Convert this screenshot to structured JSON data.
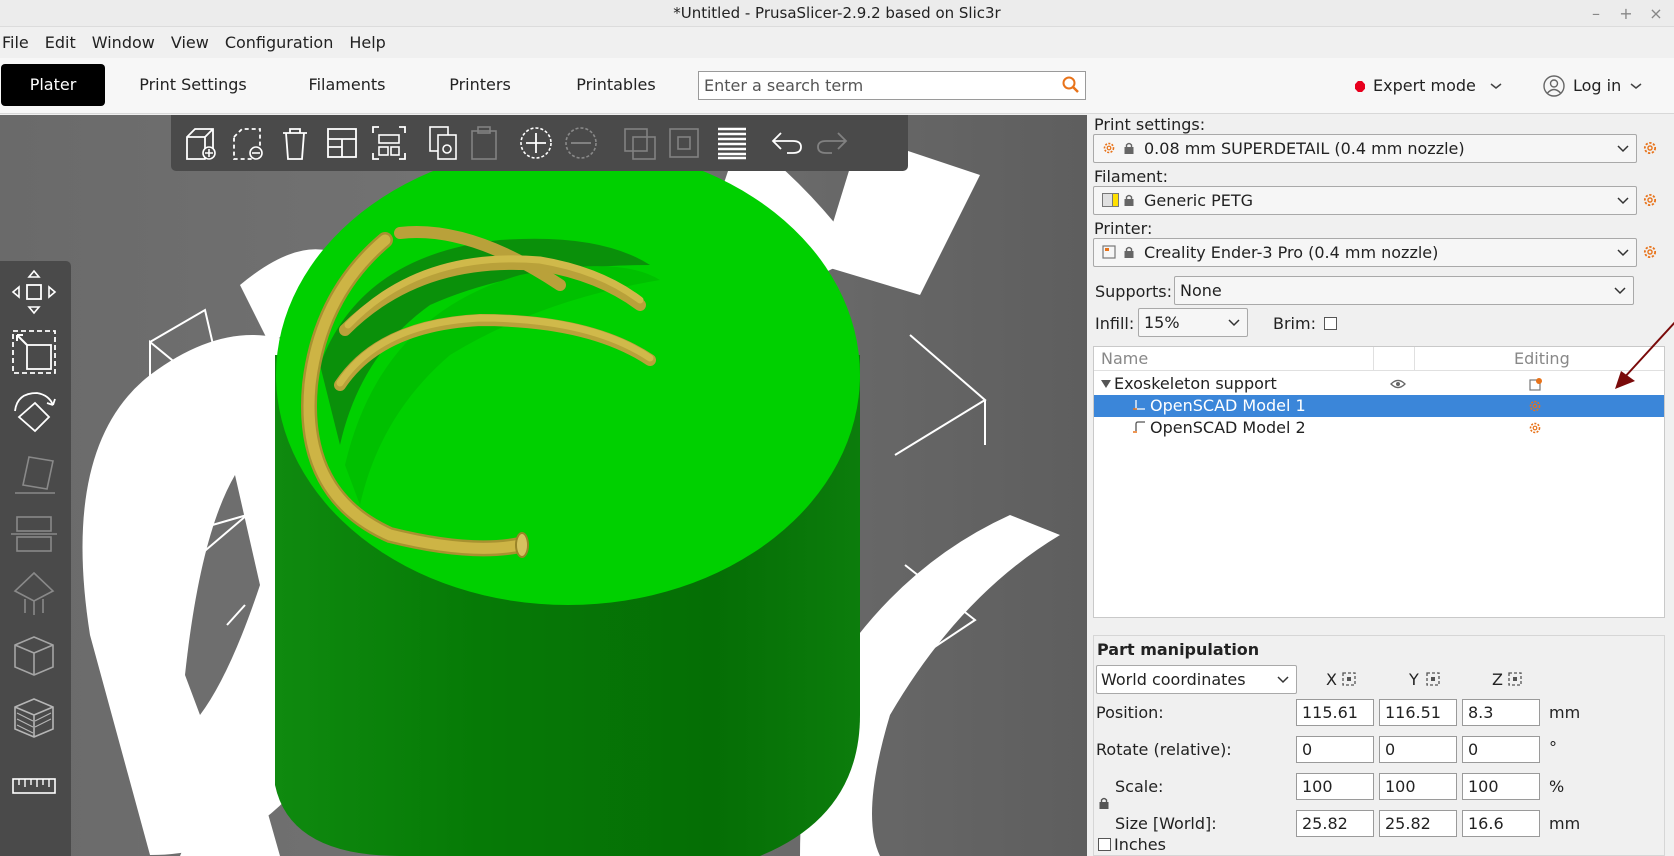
{
  "window": {
    "title": "*Untitled - PrusaSlicer-2.9.2 based on Slic3r",
    "controls": [
      "–",
      "+",
      "×"
    ]
  },
  "menu": [
    "File",
    "Edit",
    "Window",
    "View",
    "Configuration",
    "Help"
  ],
  "tabs": {
    "plater": "Plater",
    "print_settings": "Print Settings",
    "filaments": "Filaments",
    "printers": "Printers",
    "printables": "Printables"
  },
  "search": {
    "placeholder": "Enter a search term"
  },
  "mode": {
    "label": "Expert mode",
    "color": "#e8001d"
  },
  "login": {
    "label": "Log in"
  },
  "viewport": {
    "object_color": "#00cc00",
    "modifier_color": "#c8b040",
    "background": "#6e6e6e"
  },
  "panel": {
    "print_settings_label": "Print settings:",
    "print_settings_value": "0.08 mm SUPERDETAIL (0.4 mm nozzle)",
    "filament_label": "Filament:",
    "filament_value": "Generic PETG",
    "printer_label": "Printer:",
    "printer_value": "Creality Ender-3 Pro (0.4 mm nozzle)",
    "supports_label": "Supports:",
    "supports_value": "None",
    "infill_label": "Infill:",
    "infill_value": "15%",
    "brim_label": "Brim:"
  },
  "object_list": {
    "col_name": "Name",
    "col_editing": "Editing",
    "rows": [
      {
        "name": "Exoskeleton support",
        "selected": false
      },
      {
        "name": "OpenSCAD Model 1",
        "selected": true
      },
      {
        "name": "OpenSCAD Model 2",
        "selected": false
      }
    ]
  },
  "part_manipulation": {
    "title": "Part manipulation",
    "coord_system": "World coordinates",
    "axes": [
      "X",
      "Y",
      "Z"
    ],
    "position_label": "Position:",
    "position": [
      "115.61",
      "116.51",
      "8.3"
    ],
    "position_unit": "mm",
    "rotate_label": "Rotate (relative):",
    "rotate": [
      "0",
      "0",
      "0"
    ],
    "rotate_unit": "°",
    "scale_label": "Scale:",
    "scale": [
      "100",
      "100",
      "100"
    ],
    "scale_unit": "%",
    "size_label": "Size [World]:",
    "size": [
      "25.82",
      "25.82",
      "16.6"
    ],
    "size_unit": "mm",
    "inches_label": "Inches"
  }
}
